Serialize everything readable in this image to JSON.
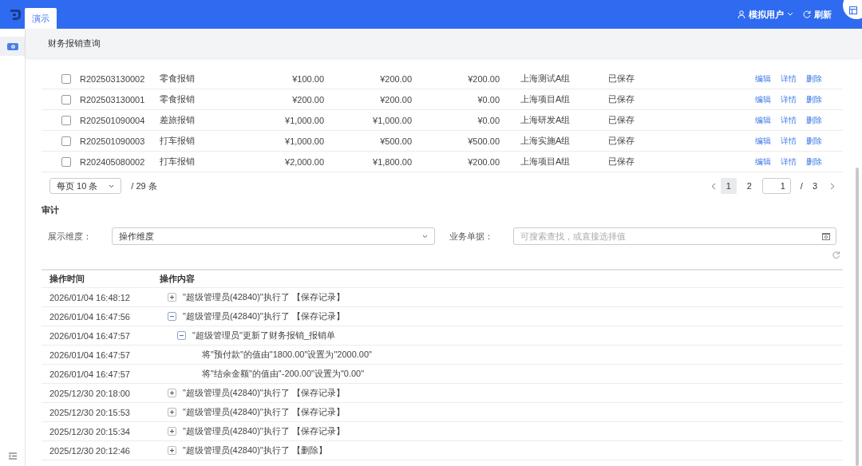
{
  "header": {
    "tab": {
      "label": "演示",
      "selected": true
    },
    "user": "模拟用户",
    "refresh": "刷新"
  },
  "breadcrumb": "财务报销查询",
  "expenses": {
    "rows": [
      {
        "checked": false,
        "cells": [
          "R202503130002",
          "零食报销",
          "¥100.00",
          "¥200.00",
          "¥200.00",
          "上海测试A组",
          "已保存"
        ],
        "actions": [
          "编辑",
          "详情",
          "删除"
        ]
      },
      {
        "checked": false,
        "cells": [
          "R202503130001",
          "零食报销",
          "¥200.00",
          "¥200.00",
          "¥0.00",
          "上海项目A组",
          "已保存"
        ],
        "actions": [
          "编辑",
          "详情",
          "删除"
        ]
      },
      {
        "checked": false,
        "cells": [
          "R202501090004",
          "差旅报销",
          "¥1,000.00",
          "¥1,000.00",
          "¥0.00",
          "上海研发A组",
          "已保存"
        ],
        "actions": [
          "编辑",
          "详情",
          "删除"
        ]
      },
      {
        "checked": false,
        "cells": [
          "R202501090003",
          "打车报销",
          "¥1,000.00",
          "¥500.00",
          "¥500.00",
          "上海实施A组",
          "已保存"
        ],
        "actions": [
          "编辑",
          "详情",
          "删除"
        ]
      },
      {
        "checked": false,
        "cells": [
          "R202405080002",
          "打车报销",
          "¥2,000.00",
          "¥1,800.00",
          "¥200.00",
          "上海项目A组",
          "已保存"
        ],
        "actions": [
          "编辑",
          "详情",
          "删除"
        ]
      }
    ],
    "pagination": {
      "page_size": "每页 10 条",
      "total": "/ 29 条",
      "pages": [
        {
          "label": "1",
          "selected": true
        },
        {
          "label": "2",
          "selected": false
        }
      ],
      "jump_value": "1",
      "separator": "/",
      "page_count": "3"
    }
  },
  "audit": {
    "title": "审计",
    "filters": [
      {
        "kind": "select",
        "label": "展示维度：",
        "value": "操作维度"
      },
      {
        "kind": "lookup",
        "label": "业务单据：",
        "placeholder": "可搜索查找，或直接选择值"
      }
    ],
    "columns": [
      "操作时间",
      "操作内容"
    ],
    "rows": [
      {
        "kind": "toggle",
        "expanded": false,
        "time": "2026/01/04 16:48:12",
        "content": "\"超级管理员(42840)\"执行了 【保存记录】"
      },
      {
        "kind": "toggle",
        "expanded": true,
        "time": "2026/01/04 16:47:56",
        "content": "\"超级管理员(42840)\"执行了 【保存记录】",
        "children": [
          {
            "kind": "toggle",
            "expanded": true,
            "time": "2026/01/04 16:47:57",
            "content": "\"超级管理员\"更新了财务报销_报销单",
            "children": [
              {
                "kind": "leaf",
                "time": "2026/01/04 16:47:57",
                "content": "将\"预付款\"的值由\"1800.00\"设置为\"2000.00\""
              },
              {
                "kind": "leaf",
                "time": "2026/01/04 16:47:57",
                "content": "将\"结余金额\"的值由\"-200.00\"设置为\"0.00\""
              }
            ]
          }
        ]
      },
      {
        "kind": "toggle",
        "expanded": false,
        "time": "2025/12/30 20:18:00",
        "content": "\"超级管理员(42840)\"执行了 【保存记录】"
      },
      {
        "kind": "toggle",
        "expanded": false,
        "time": "2025/12/30 20:15:53",
        "content": "\"超级管理员(42840)\"执行了 【保存记录】"
      },
      {
        "kind": "toggle",
        "expanded": false,
        "time": "2025/12/30 20:15:34",
        "content": "\"超级管理员(42840)\"执行了 【保存记录】"
      },
      {
        "kind": "toggle",
        "expanded": false,
        "time": "2025/12/30 20:12:46",
        "content": "\"超级管理员(42840)\"执行了 【删除】"
      }
    ]
  }
}
